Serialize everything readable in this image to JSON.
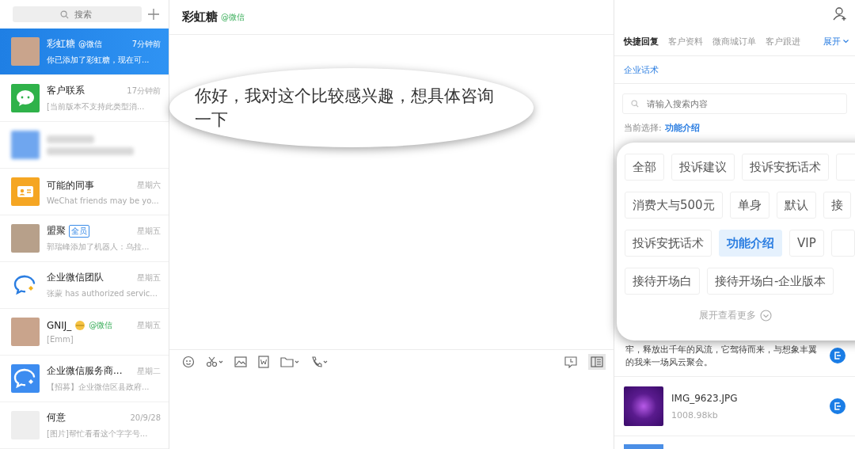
{
  "sidebar": {
    "search": {
      "placeholder": "搜索"
    },
    "chats": [
      {
        "kind": "photo",
        "name": "彩虹糖",
        "tag": {
          "kind": "wechat",
          "text": "@微信"
        },
        "time": "7分钟前",
        "preview": "你已添加了彩虹糖，现在可...",
        "selected": true
      },
      {
        "kind": "wechat",
        "name": "客户联系",
        "time": "17分钟前",
        "preview": "[当前版本不支持此类型消...",
        "selected": false
      },
      {
        "kind": "blurred",
        "selected": false
      },
      {
        "kind": "contacts",
        "name": "可能的同事",
        "time": "星期六",
        "preview": "WeChat friends may be yo...",
        "selected": false
      },
      {
        "kind": "collage",
        "name": "盟聚",
        "tag": {
          "kind": "badge",
          "text": "全员"
        },
        "time": "星期五",
        "preview": "郭瑞峰添加了机器人：乌拉...",
        "selected": false
      },
      {
        "kind": "wecom",
        "name": "企业微信团队",
        "time": "星期五",
        "preview": "张蒙 has authorized servic...",
        "selected": false
      },
      {
        "kind": "photo",
        "name": "GNIJ_",
        "emoji": true,
        "tag": {
          "kind": "wechat",
          "text": "@微信"
        },
        "time": "星期五",
        "preview": "[Emm]",
        "selected": false
      },
      {
        "kind": "wecom-box",
        "name": "企业微信服务商...",
        "time": "星期二",
        "preview": "【招募】企业微信区县政府...",
        "selected": false
      },
      {
        "kind": "document",
        "name": "何意",
        "time": "20/9/28",
        "preview": "[图片]帮忙看看这个字字号...",
        "selected": false
      }
    ]
  },
  "chat": {
    "title": "彩虹糖",
    "tag": "@微信",
    "message": "你好，我对这个比较感兴趣，想具体咨询一下"
  },
  "panel": {
    "tabs": [
      {
        "label": "快捷回复",
        "selected": true
      },
      {
        "label": "客户资料",
        "selected": false
      },
      {
        "label": "微商城订单",
        "selected": false
      },
      {
        "label": "客户跟进",
        "selected": false
      }
    ],
    "expand": "展开",
    "subtab": "企业话术",
    "search": {
      "placeholder": "请输入搜索内容"
    },
    "current_label": "当前选择:",
    "current_value": "功能介绍",
    "tag_rows": [
      [
        {
          "label": "全部",
          "selected": false
        },
        {
          "label": "投诉建议",
          "selected": false
        },
        {
          "label": "投诉安抚话术",
          "selected": false
        },
        {
          "selected": false
        }
      ],
      [
        {
          "label": "消费大与500元",
          "selected": false
        },
        {
          "label": "单身",
          "selected": false
        },
        {
          "label": "默认",
          "selected": false
        },
        {
          "label": "接",
          "selected": false
        }
      ],
      [
        {
          "label": "投诉安抚话术",
          "selected": false
        },
        {
          "label": "功能介绍",
          "selected": true
        },
        {
          "label": "VIP",
          "selected": false
        },
        {
          "selected": false
        }
      ],
      [
        {
          "label": "接待开场白",
          "selected": false
        },
        {
          "label": "接待开场白-企业版本",
          "selected": false
        }
      ]
    ],
    "more": "展开查看更多",
    "snippet": "牢，释放出千年的风流，它驾待而来，与想象丰翼的我来一场风云聚会。",
    "file": {
      "name": "IMG_9623.JPG",
      "size": "1008.98kb"
    }
  }
}
